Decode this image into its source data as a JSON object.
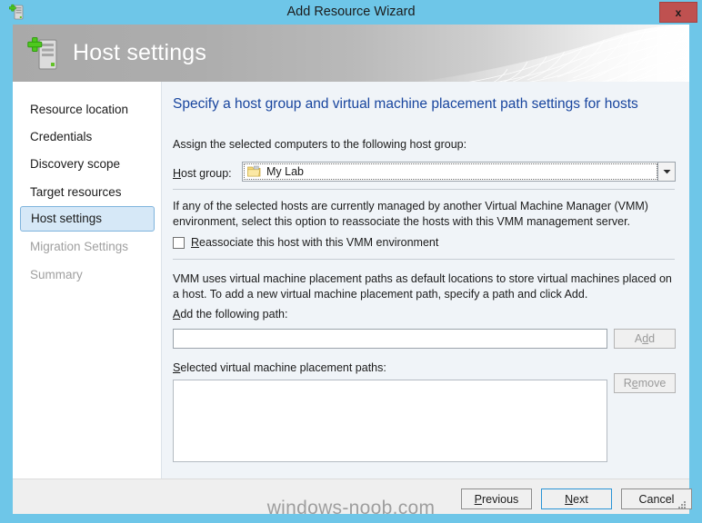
{
  "window": {
    "title": "Add Resource Wizard",
    "title_icon": "server-add-icon",
    "close_label": "x",
    "watermark": "windows-noob.com"
  },
  "banner": {
    "title": "Host settings",
    "icon": "server-add-icon"
  },
  "sidebar": {
    "items": [
      {
        "label": "Resource location",
        "state": "enabled"
      },
      {
        "label": "Credentials",
        "state": "enabled"
      },
      {
        "label": "Discovery scope",
        "state": "enabled"
      },
      {
        "label": "Target resources",
        "state": "enabled"
      },
      {
        "label": "Host settings",
        "state": "selected"
      },
      {
        "label": "Migration Settings",
        "state": "disabled"
      },
      {
        "label": "Summary",
        "state": "disabled"
      }
    ]
  },
  "content": {
    "heading": "Specify a host group and virtual machine placement path settings for hosts",
    "assign_label": "Assign the selected computers to the following host group:",
    "hostgroup": {
      "label_prefix": "H",
      "label_rest": "ost group:",
      "value": "My Lab",
      "folder_icon": "folder-icon",
      "arrow_icon": "chevron-down-icon"
    },
    "reassociate": {
      "description": "If any of the selected hosts are currently managed by another Virtual Machine Manager (VMM) environment, select this option to reassociate the hosts with this VMM management server.",
      "checkbox_prefix": "R",
      "checkbox_rest": "eassociate this host with this VMM environment",
      "checked": false
    },
    "paths": {
      "description": "VMM uses virtual machine placement paths as default locations to store virtual machines placed on a host. To add a new virtual machine placement path, specify a path and click Add.",
      "add_label_prefix": "A",
      "add_label_rest": "dd the following path:",
      "input_value": "",
      "input_placeholder": "",
      "add_button_pre": "A",
      "add_button_accel": "d",
      "add_button_post": "d",
      "add_button_enabled": false,
      "selected_label_prefix": "S",
      "selected_label_rest": "elected virtual machine placement paths:",
      "remove_button_pre": "R",
      "remove_button_accel": "e",
      "remove_button_post": "move",
      "remove_button_enabled": false,
      "list_items": []
    }
  },
  "footer": {
    "previous_prefix": "P",
    "previous_rest": "revious",
    "next_prefix": "N",
    "next_rest": "ext",
    "cancel_label": "Cancel"
  },
  "colors": {
    "window_frame": "#6ec6e8",
    "close_button": "#bf5150",
    "heading_text": "#18459e",
    "selected_nav_bg": "#d6e8f7",
    "selected_nav_border": "#7fb4dd",
    "content_bg": "#f0f4f8",
    "footer_bg": "#efefef",
    "default_button_border": "#2a94d6"
  }
}
